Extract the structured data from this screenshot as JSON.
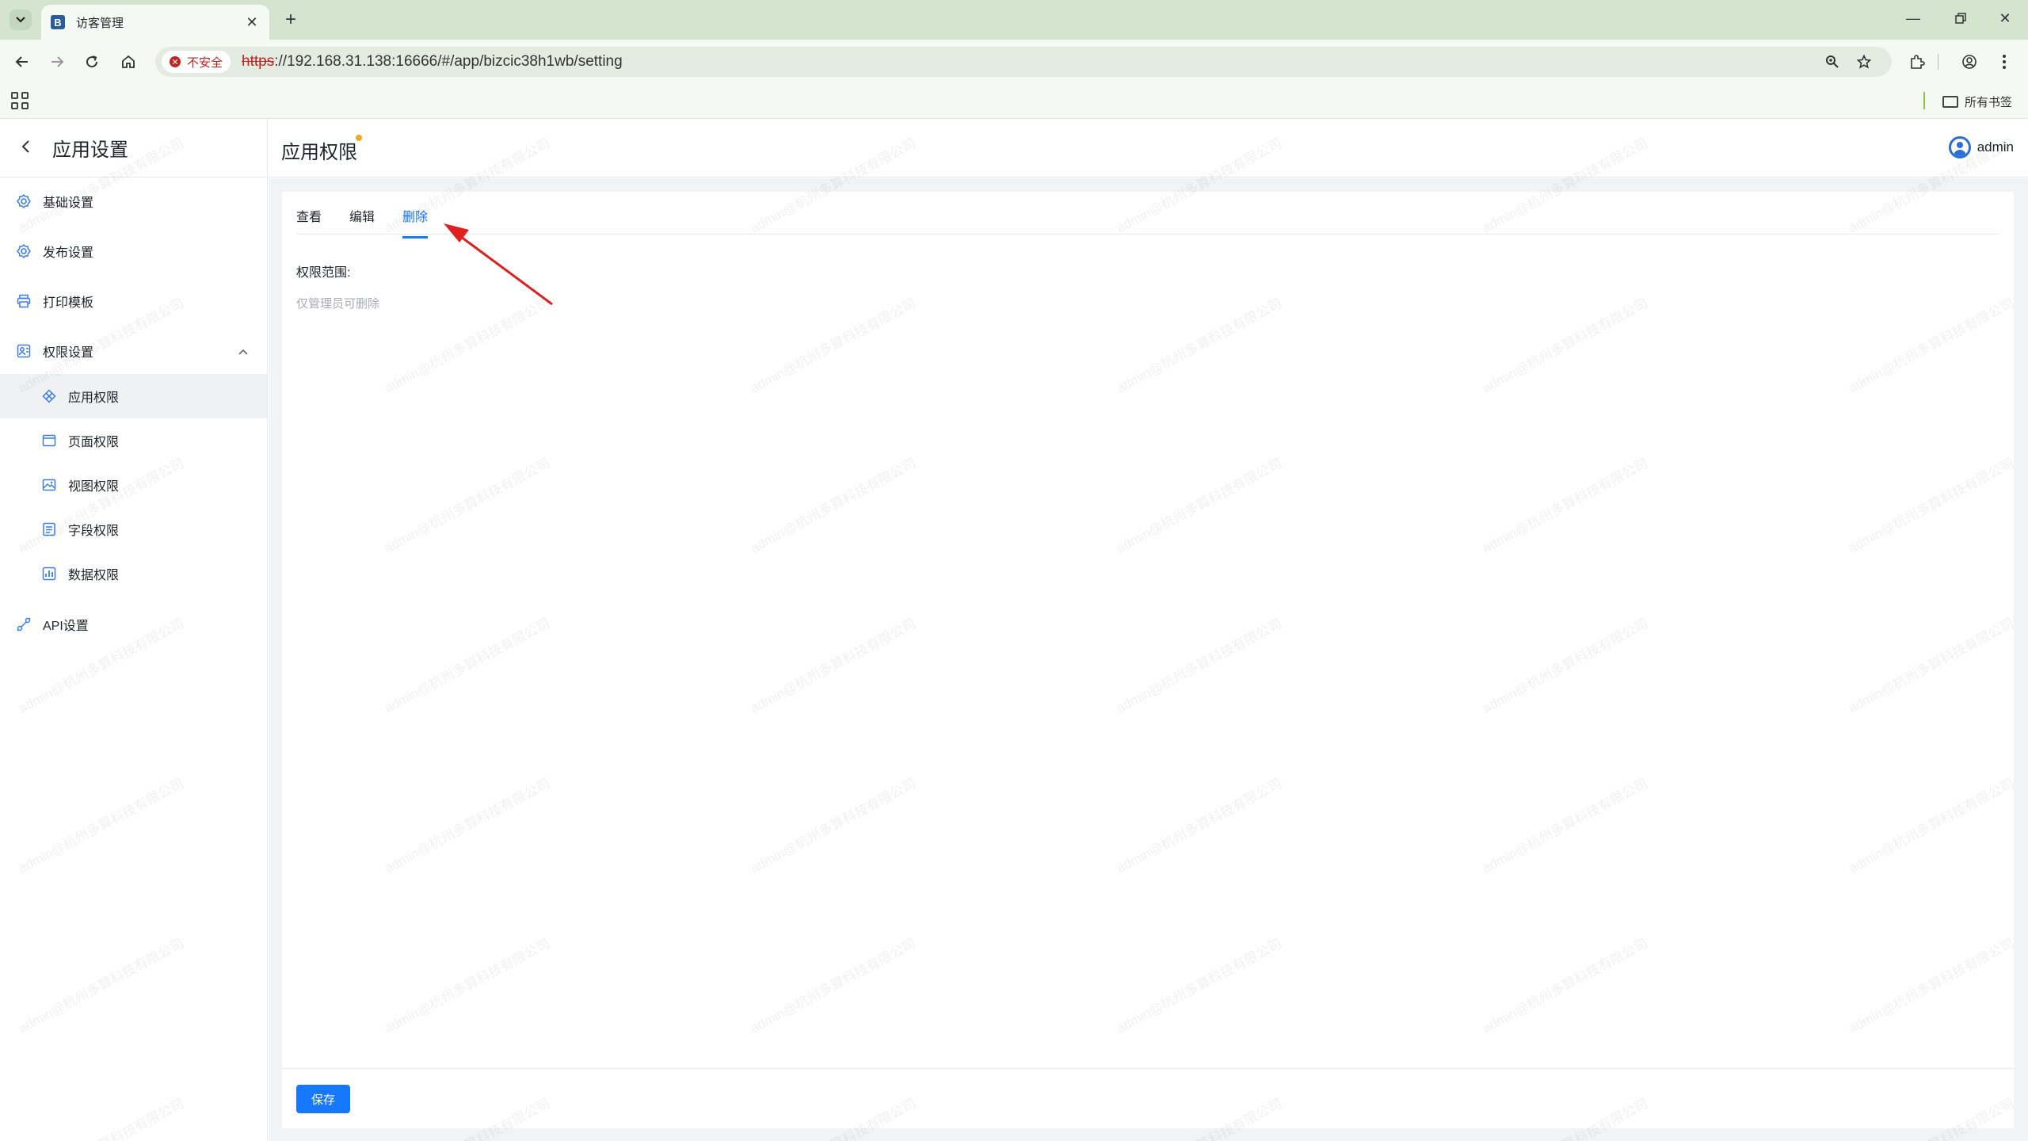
{
  "browser": {
    "tab_title": "访客管理",
    "tab_favicon_letter": "B",
    "url_security": "不安全",
    "url_scheme": "https",
    "url_rest": "://192.168.31.138:16666/#/app/bizcic38h1wb/setting",
    "bookmarks_all": "所有书签"
  },
  "sidebar": {
    "title": "应用设置",
    "items": [
      {
        "label": "基础设置",
        "icon": "gear-icon"
      },
      {
        "label": "发布设置",
        "icon": "gear-icon"
      },
      {
        "label": "打印模板",
        "icon": "printer-icon"
      },
      {
        "label": "权限设置",
        "icon": "permission-icon"
      },
      {
        "label": "API设置",
        "icon": "api-icon"
      }
    ],
    "sub_items": [
      {
        "label": "应用权限",
        "icon": "app-icon",
        "active": true
      },
      {
        "label": "页面权限",
        "icon": "page-icon"
      },
      {
        "label": "视图权限",
        "icon": "image-icon"
      },
      {
        "label": "字段权限",
        "icon": "field-icon"
      },
      {
        "label": "数据权限",
        "icon": "data-icon"
      }
    ]
  },
  "header": {
    "page_title": "应用权限",
    "username": "admin"
  },
  "panel": {
    "tabs": [
      {
        "label": "查看"
      },
      {
        "label": "编辑"
      },
      {
        "label": "删除",
        "active": true
      }
    ],
    "field_label": "权限范围:",
    "field_value": "仅管理员可删除",
    "save_label": "保存"
  },
  "watermark_text": "admin@杭州多算科技有限公司",
  "colors": {
    "accent": "#1677ff",
    "chrome_bg": "#d4e4cf",
    "annotation_arrow": "#e02020"
  }
}
